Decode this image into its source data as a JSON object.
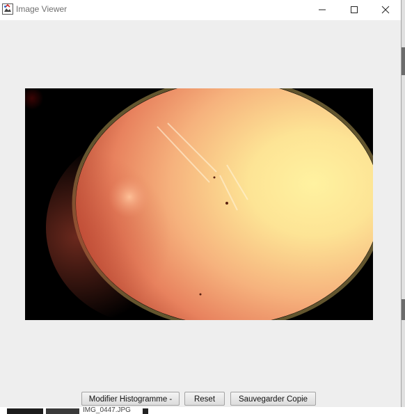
{
  "window": {
    "title": "Image Viewer"
  },
  "titlebar": {
    "icons": {
      "app": "java-app-icon",
      "minimize": "minimize-icon",
      "maximize": "maximize-icon",
      "close": "close-icon"
    }
  },
  "buttons": {
    "modify_histogram": "Modifier Histogramme -",
    "reset": "Reset",
    "save_copy": "Sauvegarder Copie"
  },
  "background_peek": {
    "file_label": "IMG_0447.JPG"
  },
  "colors": {
    "window_bg": "#eeeeee",
    "titlebar_bg": "#ffffff",
    "image_bg": "#000000"
  }
}
